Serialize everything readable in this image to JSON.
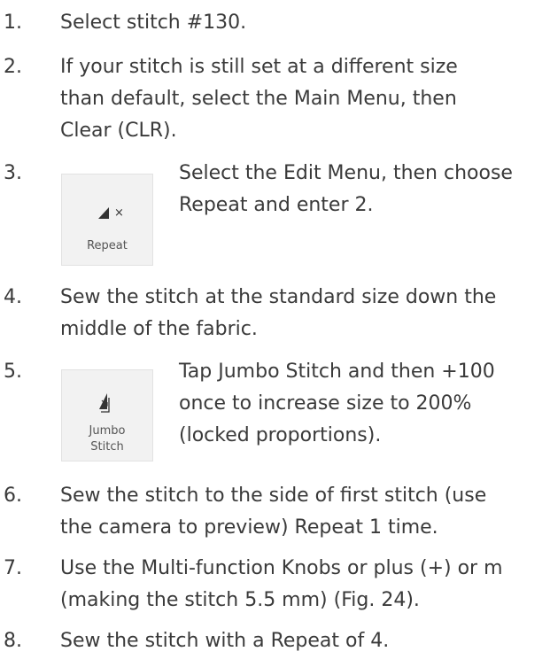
{
  "steps": [
    {
      "number": "1.",
      "lines": [
        "Select stitch #130."
      ]
    },
    {
      "number": "2.",
      "lines": [
        "If your stitch is still set at a different size",
        "than default, select the Main Menu, then",
        "Clear (CLR)."
      ]
    },
    {
      "number": "3.",
      "icon": {
        "name": "repeat-icon",
        "label_lines": [
          "Repeat"
        ]
      },
      "lines": [
        "Select the Edit Menu, then choose",
        "Repeat and enter 2."
      ]
    },
    {
      "number": "4.",
      "lines": [
        "Sew the stitch at the standard size down the",
        "middle of the fabric."
      ]
    },
    {
      "number": "5.",
      "icon": {
        "name": "jumbo-stitch-icon",
        "label_lines": [
          "Jumbo",
          "Stitch"
        ]
      },
      "lines": [
        "Tap Jumbo Stitch and then +100",
        "once to increase size to 200%",
        "(locked proportions)."
      ]
    },
    {
      "number": "6.",
      "lines": [
        "Sew the stitch to the side of first stitch (use",
        "the camera to preview) Repeat 1 time."
      ]
    },
    {
      "number": "7.",
      "lines": [
        "Use the Multi-function Knobs or plus (+) or m",
        "(making the stitch 5.5 mm) (Fig. 24)."
      ]
    },
    {
      "number": "8.",
      "lines": [
        "Sew the stitch with a Repeat of 4."
      ]
    }
  ]
}
